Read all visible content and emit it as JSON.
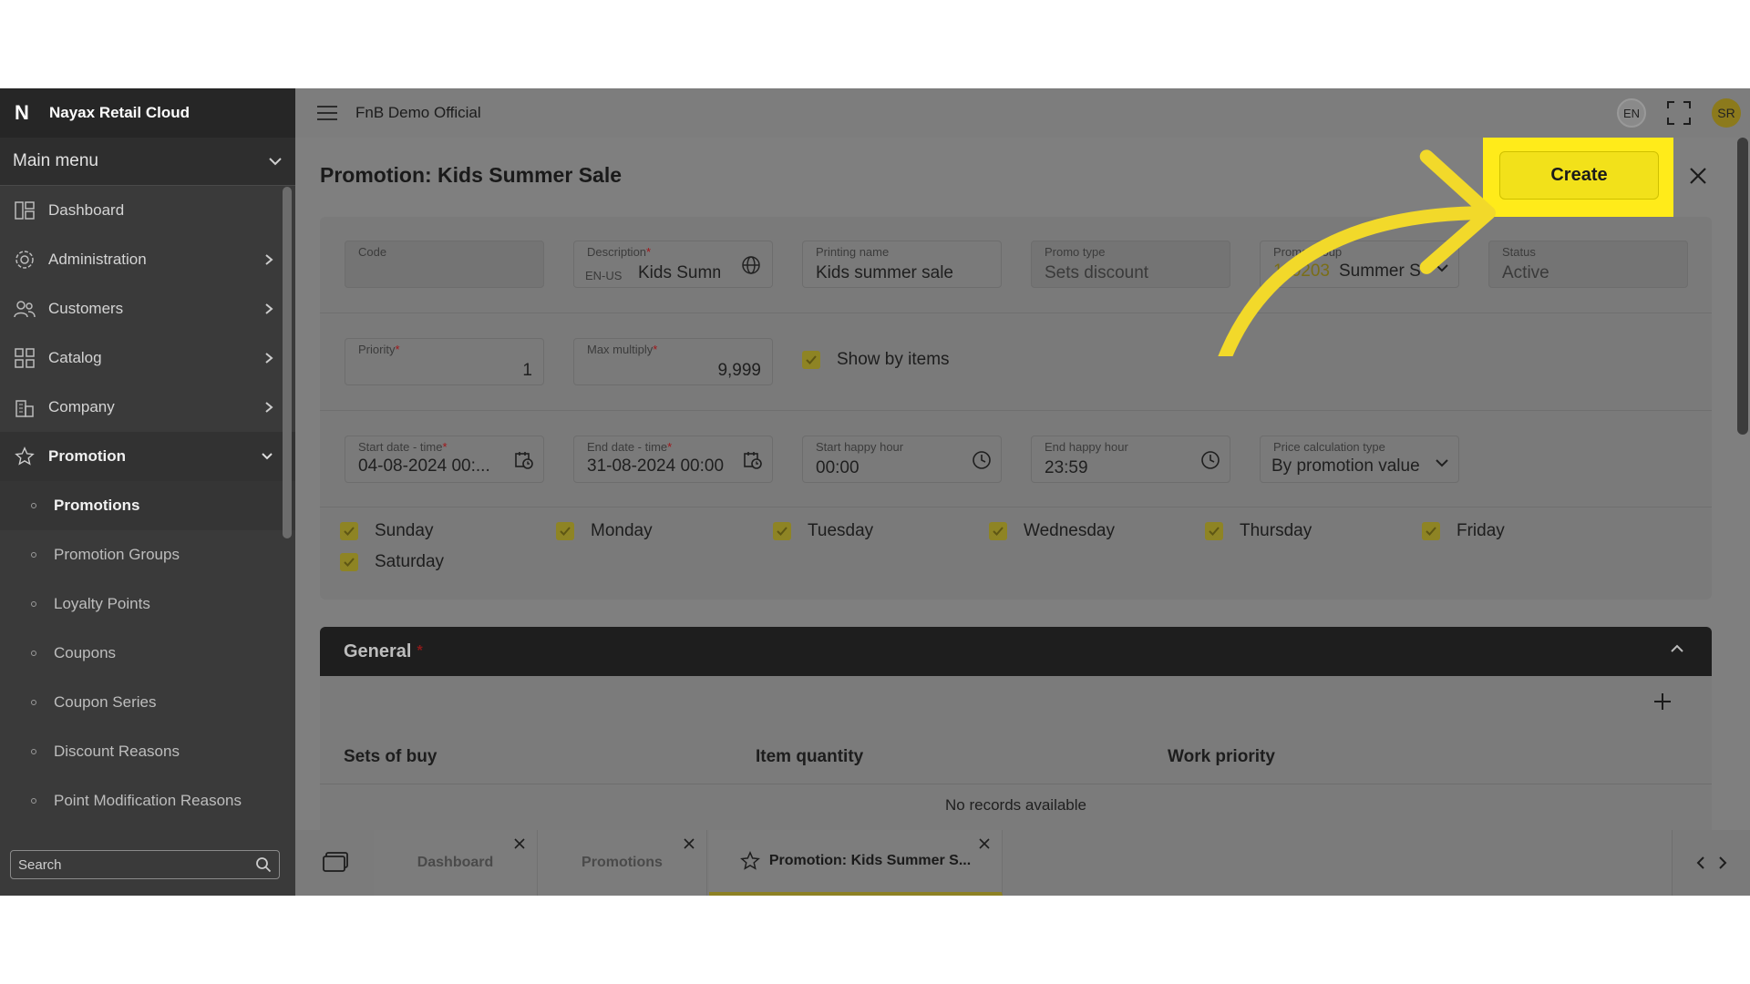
{
  "app": {
    "brand": "Nayax Retail Cloud",
    "company": "FnB Demo Official",
    "language": "EN",
    "user_initials": "SR"
  },
  "sidebar": {
    "main_menu": "Main menu",
    "items": [
      {
        "label": "Dashboard",
        "icon": "dashboard-icon"
      },
      {
        "label": "Administration",
        "icon": "administration-icon"
      },
      {
        "label": "Customers",
        "icon": "customers-icon"
      },
      {
        "label": "Catalog",
        "icon": "catalog-icon"
      },
      {
        "label": "Company",
        "icon": "company-icon"
      },
      {
        "label": "Promotion",
        "icon": "star-icon"
      }
    ],
    "sub_items": [
      "Promotions",
      "Promotion Groups",
      "Loyalty Points",
      "Coupons",
      "Coupon Series",
      "Discount Reasons",
      "Point Modification Reasons"
    ],
    "search_placeholder": "Search"
  },
  "page": {
    "title": "Promotion: Kids Summer Sale",
    "create_label": "Create"
  },
  "form": {
    "code": {
      "label": "Code",
      "value": ""
    },
    "description": {
      "label": "Description",
      "lang": "EN-US",
      "value": "Kids Summ"
    },
    "printing_name": {
      "label": "Printing name",
      "value": "Kids summer sale"
    },
    "promo_type": {
      "label": "Promo type",
      "value": "Sets discount"
    },
    "promo_group": {
      "label": "Promo group",
      "code": "110203",
      "value": "Summer S"
    },
    "status": {
      "label": "Status",
      "value": "Active"
    },
    "priority": {
      "label": "Priority",
      "value": "1"
    },
    "max_multiply": {
      "label": "Max multiply",
      "value": "9,999"
    },
    "show_by_items": {
      "label": "Show by items",
      "checked": true
    },
    "start_date": {
      "label": "Start date - time",
      "value": "04-08-2024 00:..."
    },
    "end_date": {
      "label": "End date - time",
      "value": "31-08-2024 00:00"
    },
    "start_happy": {
      "label": "Start happy hour",
      "value": "00:00"
    },
    "end_happy": {
      "label": "End happy hour",
      "value": "23:59"
    },
    "price_calc": {
      "label": "Price calculation type",
      "value": "By promotion value"
    },
    "days": [
      "Sunday",
      "Monday",
      "Tuesday",
      "Wednesday",
      "Thursday",
      "Friday",
      "Saturday"
    ]
  },
  "general": {
    "title": "General",
    "required_mark": "*",
    "columns": [
      "Sets of buy",
      "Item quantity",
      "Work priority"
    ],
    "empty": "No records available"
  },
  "tabs": [
    "Dashboard",
    "Promotions",
    "Promotion: Kids Summer S..."
  ],
  "colors": {
    "highlight": "#ffeb1a",
    "create_button": "#f2e11a",
    "accent_check": "#8e8424"
  }
}
